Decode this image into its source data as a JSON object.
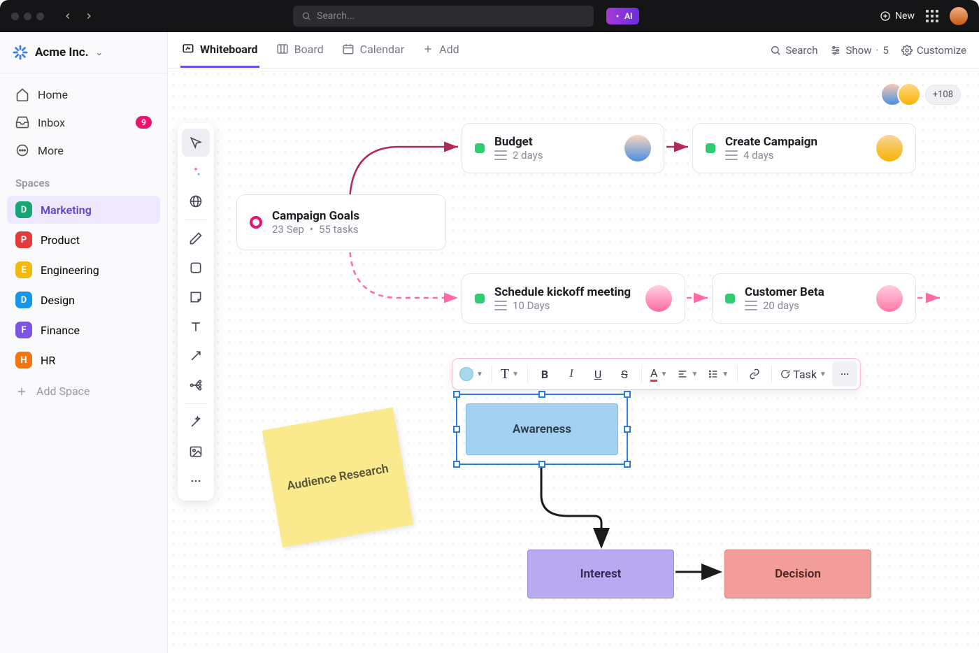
{
  "topbar": {
    "search_placeholder": "Search...",
    "ai_label": "AI",
    "new_label": "New"
  },
  "workspace": {
    "name": "Acme Inc."
  },
  "nav": {
    "home": "Home",
    "inbox": "Inbox",
    "inbox_badge": "9",
    "more": "More"
  },
  "spaces_label": "Spaces",
  "spaces": [
    {
      "letter": "D",
      "name": "Marketing",
      "color": "#17a673",
      "active": true
    },
    {
      "letter": "P",
      "name": "Product",
      "color": "#e23b3b"
    },
    {
      "letter": "E",
      "name": "Engineering",
      "color": "#f2b90f"
    },
    {
      "letter": "D",
      "name": "Design",
      "color": "#1596e8"
    },
    {
      "letter": "F",
      "name": "Finance",
      "color": "#7b54e0"
    },
    {
      "letter": "H",
      "name": "HR",
      "color": "#f07613"
    }
  ],
  "add_space": "Add Space",
  "views": {
    "whiteboard": "Whiteboard",
    "board": "Board",
    "calendar": "Calendar",
    "add": "Add"
  },
  "view_actions": {
    "search": "Search",
    "show": "Show",
    "show_count": "5",
    "customize": "Customize"
  },
  "presence": {
    "more": "+108"
  },
  "cards": {
    "goals": {
      "title": "Campaign Goals",
      "date": "23 Sep",
      "tasks": "55 tasks"
    },
    "budget": {
      "title": "Budget",
      "meta": "2 days"
    },
    "create": {
      "title": "Create Campaign",
      "meta": "4 days"
    },
    "kickoff": {
      "title": "Schedule kickoff meeting",
      "meta": "10 Days"
    },
    "beta": {
      "title": "Customer Beta",
      "meta": "20 days"
    }
  },
  "sticky": {
    "text": "Audience Research"
  },
  "flow": {
    "awareness": "Awareness",
    "interest": "Interest",
    "decision": "Decision"
  },
  "fmt": {
    "task": "Task"
  },
  "avatars": {
    "c1": "#4a90e2",
    "c2": "#f7b500",
    "c3": "#ff7aa8",
    "c4": "#f08c2e"
  }
}
